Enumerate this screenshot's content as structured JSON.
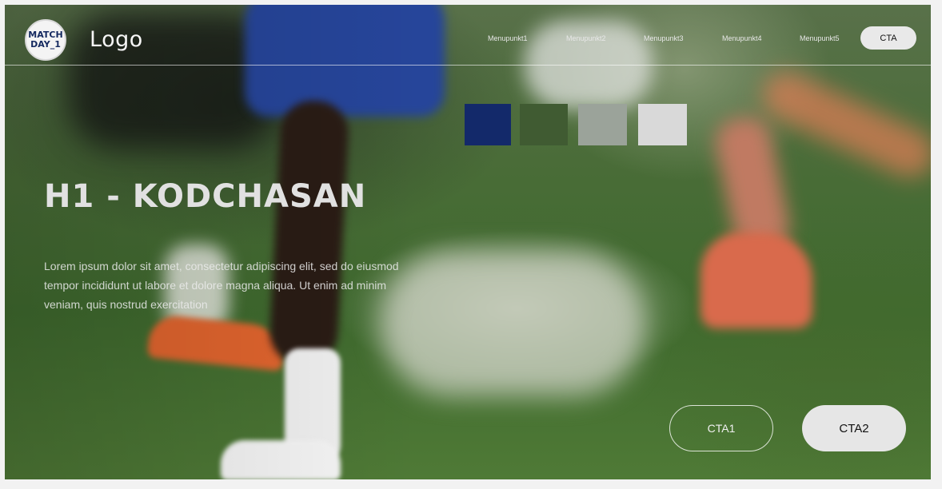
{
  "nav": {
    "badge_line1": "MATCH",
    "badge_line2": "DAY_1",
    "logo_text": "Logo",
    "menu": [
      "Menupunkt1",
      "Menupunkt2",
      "Menupunkt3",
      "Menupunkt4",
      "Menupunkt5"
    ],
    "cta": "CTA"
  },
  "hero": {
    "headline": "H1 - KODCHASAN",
    "paragraph": "Lorem ipsum dolor sit amet, consectetur adipiscing elit, sed do eiusmod tempor incididunt ut labore et dolore magna aliqua. Ut enim ad minim veniam, quis nostrud exercitation",
    "cta1": "CTA1",
    "cta2": "CTA2"
  },
  "palette": [
    "#13296a",
    "#405b32",
    "#9ba39a",
    "#d9d9d9"
  ]
}
